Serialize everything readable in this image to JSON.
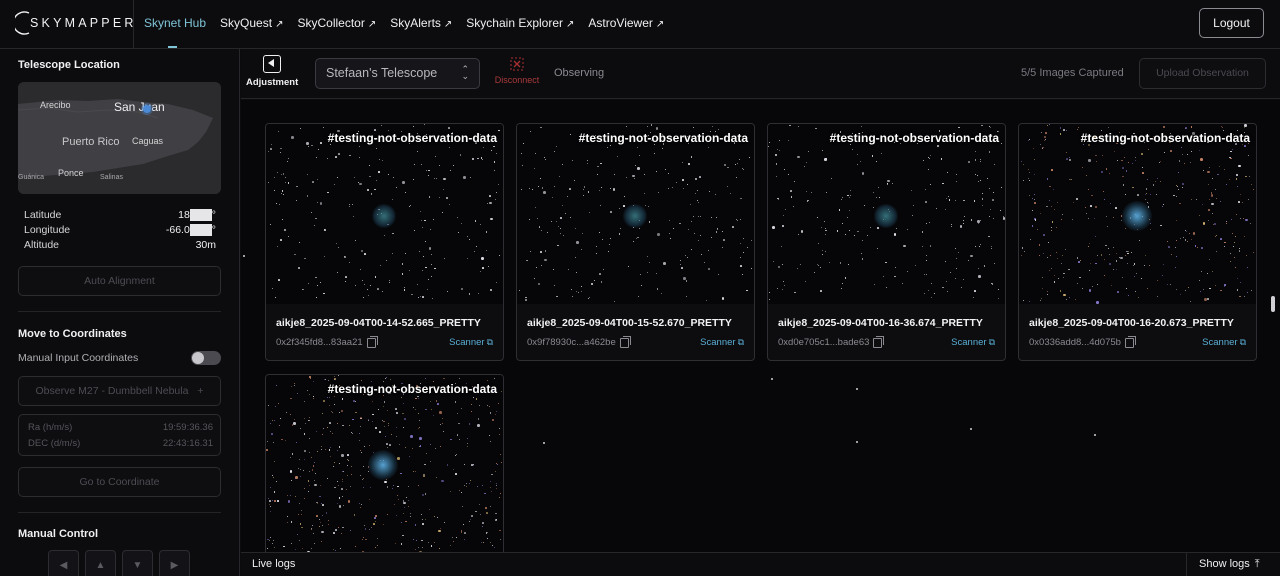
{
  "brand": {
    "name": "SKYMAPPER"
  },
  "nav": {
    "links": [
      {
        "label": "Skynet Hub",
        "external": false,
        "active": true
      },
      {
        "label": "SkyQuest",
        "external": true
      },
      {
        "label": "SkyCollector",
        "external": true
      },
      {
        "label": "SkyAlerts",
        "external": true
      },
      {
        "label": "Skychain Explorer",
        "external": true
      },
      {
        "label": "AstroViewer",
        "external": true
      }
    ],
    "external_arrow": "↗",
    "logout_label": "Logout"
  },
  "sidebar": {
    "location_title": "Telescope Location",
    "map": {
      "labels": {
        "san_juan": "San Juan",
        "arecibo": "Arecibo",
        "puerto_rico": "Puerto Rico",
        "caguas": "Caguas",
        "ponce": "Ponce",
        "salinas": "Salinas",
        "guanica": "Guánica"
      }
    },
    "latitude": {
      "label": "Latitude",
      "value_prefix": "18",
      "value_suffix": "°"
    },
    "longitude": {
      "label": "Longitude",
      "value_prefix": "-66.0",
      "value_suffix": "°"
    },
    "altitude": {
      "label": "Altitude",
      "value": "30m"
    },
    "auto_alignment_label": "Auto Alignment",
    "move_title": "Move to Coordinates",
    "manual_input_label": "Manual Input Coordinates",
    "manual_input_enabled": false,
    "observe_label": "Observe M27 - Dumbbell Nebula",
    "observe_plus": "+",
    "ra": {
      "label": "Ra (h/m/s)",
      "value": "19:59:36.36"
    },
    "dec": {
      "label": "DEC (d/m/s)",
      "value": "22:43:16.31"
    },
    "goto_label": "Go to Coordinate",
    "manual_control_title": "Manual Control",
    "arrows": [
      "◀",
      "▲",
      "▼",
      "▶"
    ]
  },
  "toolbar": {
    "adjustment_label": "Adjustment",
    "telescope_selected": "Stefaan's Telescope",
    "disconnect_label": "Disconnect",
    "status": "Observing",
    "captured": "5/5 Images Captured",
    "upload_label": "Upload Observation"
  },
  "observations": [
    {
      "tag": "#testing-not-observation-data",
      "filename": "aikje8_2025-09-04T00-14-52.665_PRETTY",
      "hash": "0x2f345fd8...83aa21",
      "scanner": "Scanner"
    },
    {
      "tag": "#testing-not-observation-data",
      "filename": "aikje8_2025-09-04T00-15-52.670_PRETTY",
      "hash": "0x9f78930c...a462be",
      "scanner": "Scanner"
    },
    {
      "tag": "#testing-not-observation-data",
      "filename": "aikje8_2025-09-04T00-16-36.674_PRETTY",
      "hash": "0xd0e705c1...bade63",
      "scanner": "Scanner"
    },
    {
      "tag": "#testing-not-observation-data",
      "filename": "aikje8_2025-09-04T00-16-20.673_PRETTY",
      "hash": "0x0336add8...4d075b",
      "scanner": "Scanner"
    },
    {
      "tag": "#testing-not-observation-data",
      "filename": "",
      "hash": "",
      "scanner": ""
    }
  ],
  "logs": {
    "title": "Live logs",
    "show_label": "Show logs",
    "show_icon": "⤒"
  },
  "colors": {
    "accent": "#7fc4d6",
    "link": "#5aaed4",
    "danger": "#a83030"
  }
}
